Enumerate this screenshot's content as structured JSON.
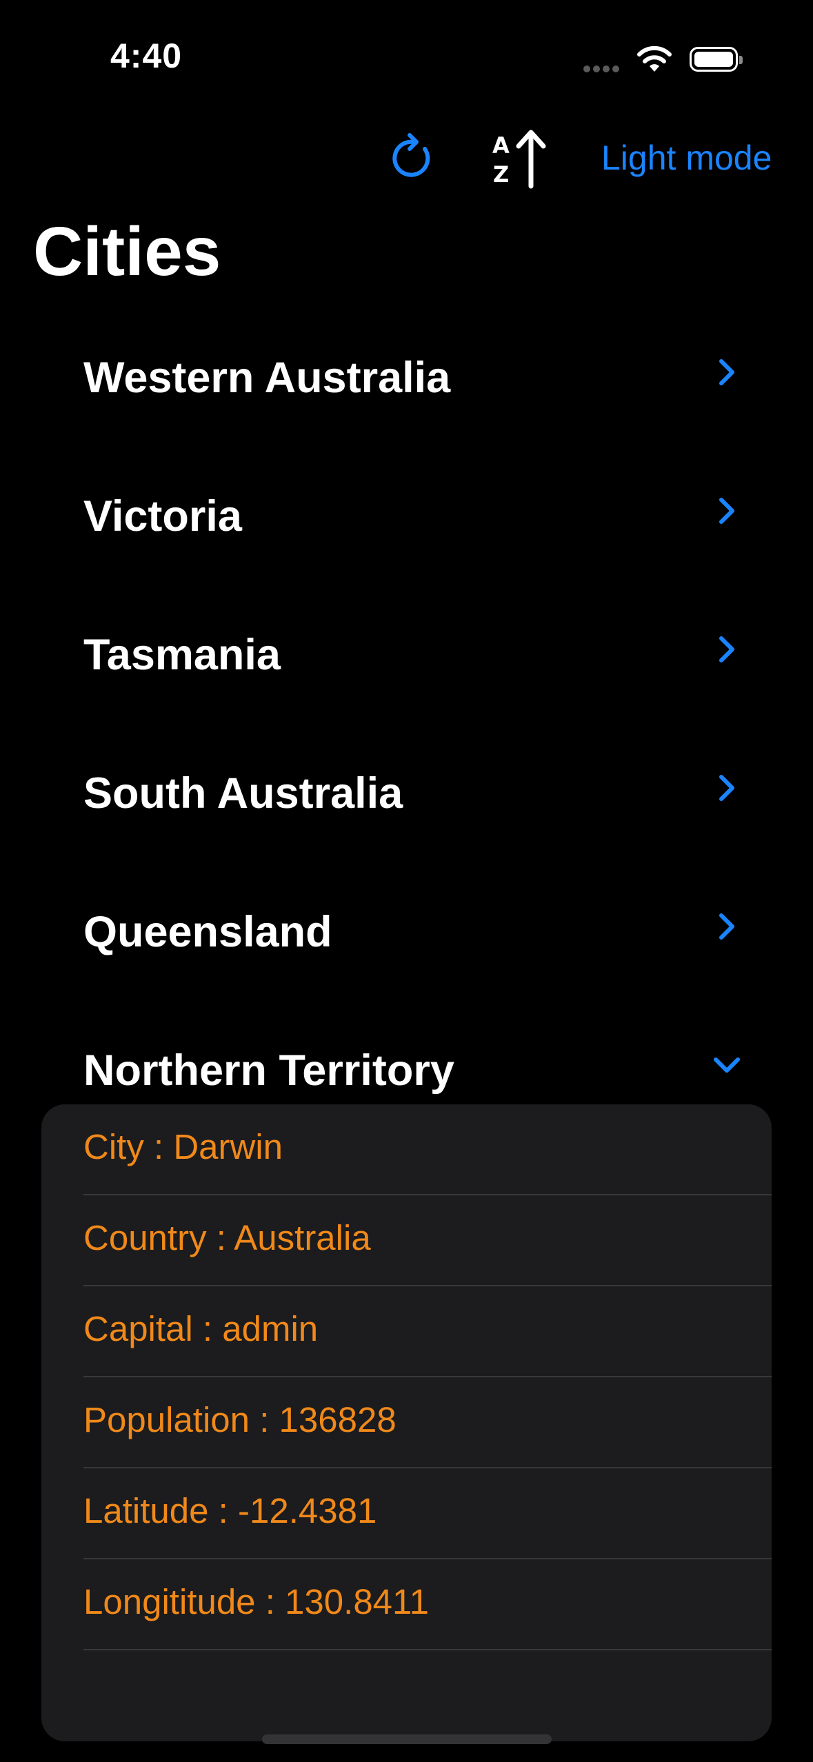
{
  "status_bar": {
    "time": "4:40",
    "wifi_icon": "wifi-icon",
    "battery_icon": "battery-icon",
    "signal_icon": "cellular-dots-icon"
  },
  "toolbar": {
    "refresh_icon": "refresh-icon",
    "sort_icon": "sort-az-ascending-icon",
    "light_mode_label": "Light mode"
  },
  "title": "Cities",
  "colors": {
    "accent": "#1a84ff",
    "detail_text": "#f0891a",
    "background": "#000000",
    "card_background": "#1c1c1e"
  },
  "regions": [
    {
      "name": "Western Australia",
      "expanded": false
    },
    {
      "name": "Victoria",
      "expanded": false
    },
    {
      "name": "Tasmania",
      "expanded": false
    },
    {
      "name": "South Australia",
      "expanded": false
    },
    {
      "name": "Queensland",
      "expanded": false
    },
    {
      "name": "Northern Territory",
      "expanded": true
    }
  ],
  "details": [
    "City : Darwin",
    "Country : Australia",
    "Capital : admin",
    "Population : 136828",
    "Latitude : -12.4381",
    "Longititude : 130.8411"
  ]
}
